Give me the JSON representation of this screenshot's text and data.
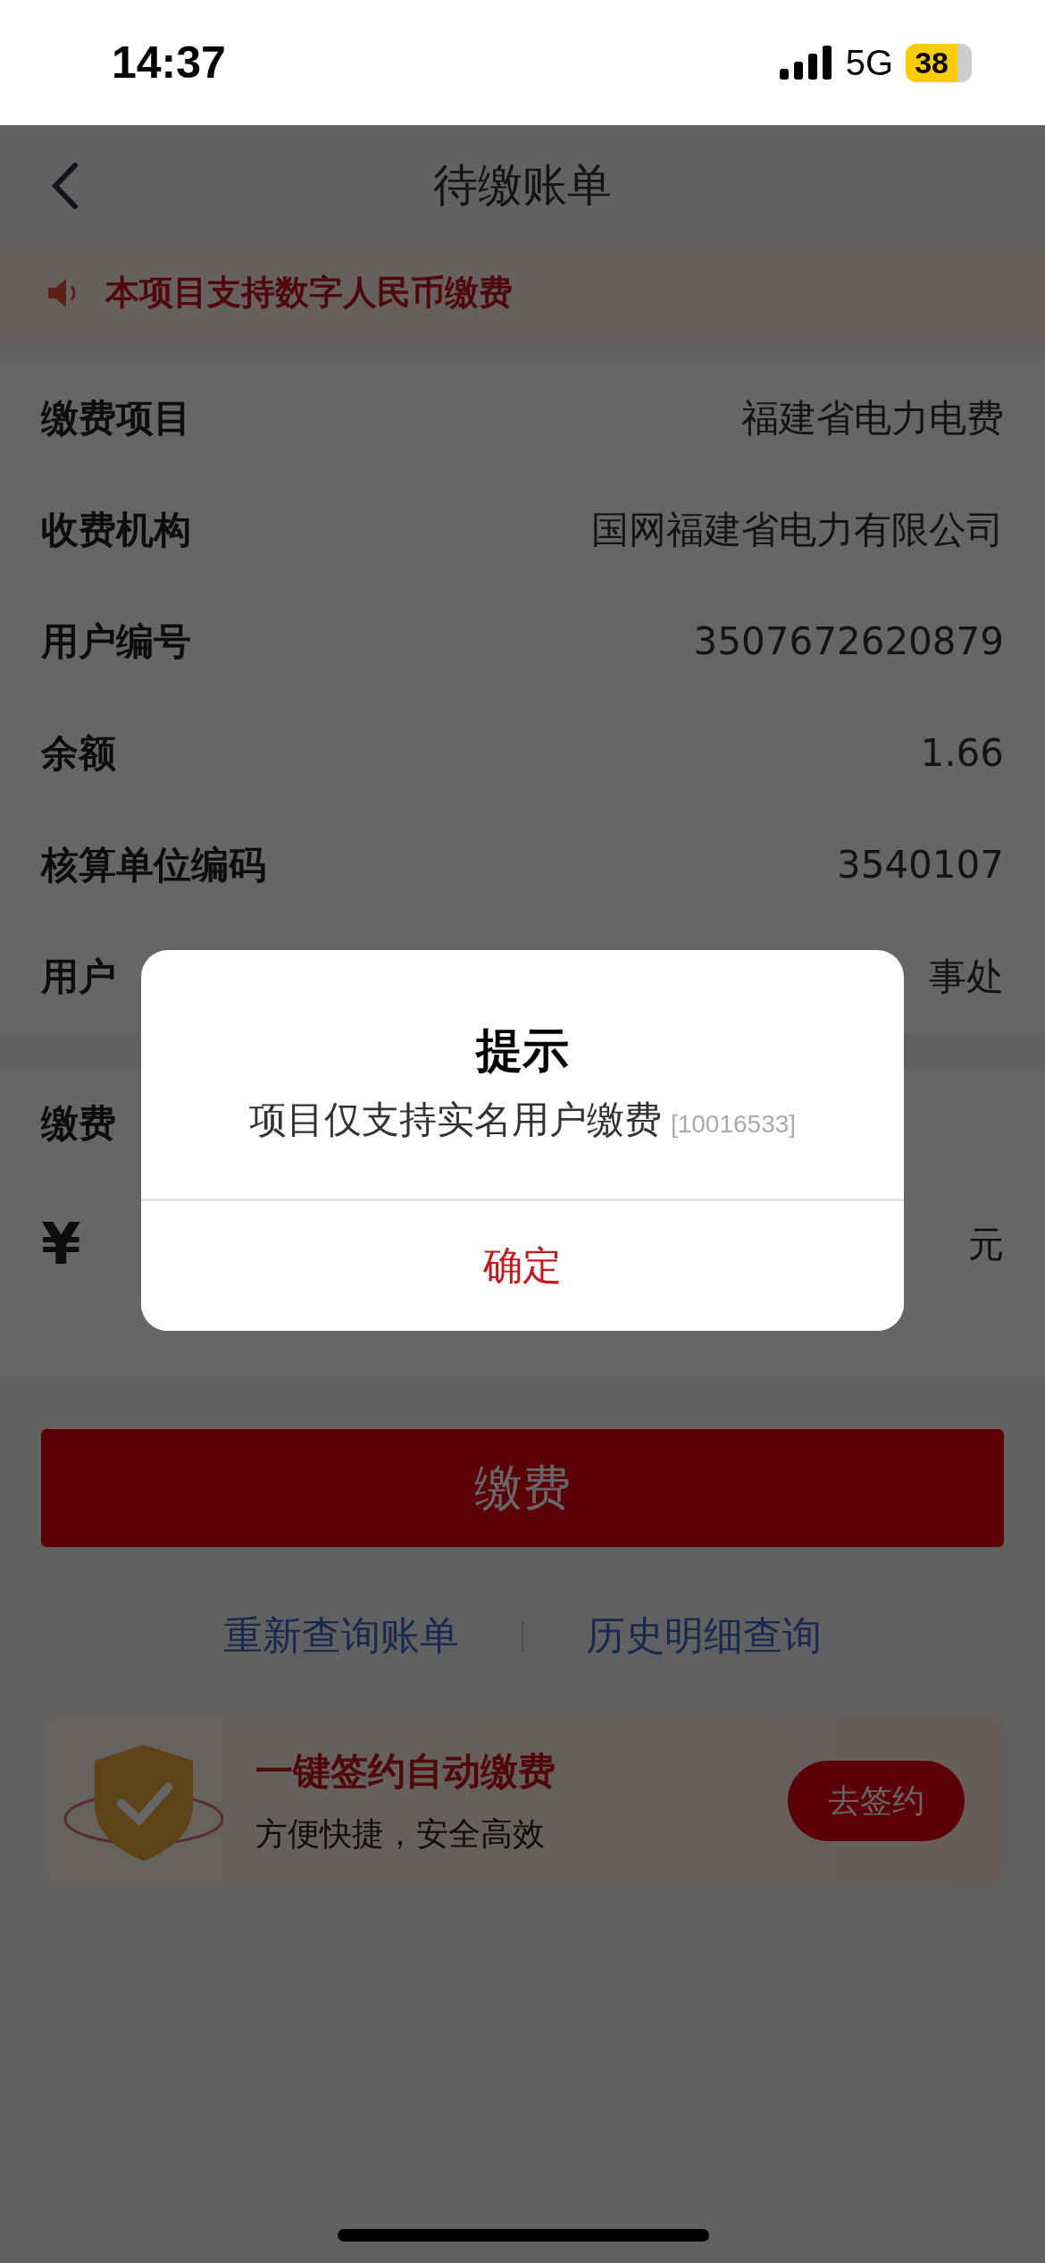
{
  "status_bar": {
    "time": "14:37",
    "network": "5G",
    "battery": "38"
  },
  "nav": {
    "title": "待缴账单"
  },
  "notice": {
    "text": "本项目支持数字人民币缴费"
  },
  "info_rows": [
    {
      "label": "缴费项目",
      "value": "福建省电力电费"
    },
    {
      "label": "收费机构",
      "value": "国网福建省电力有限公司"
    },
    {
      "label": "用户编号",
      "value": "3507672620879"
    },
    {
      "label": "余额",
      "value": "1.66"
    },
    {
      "label": "核算单位编码",
      "value": "3540107"
    },
    {
      "label": "用户",
      "value": "事处"
    }
  ],
  "amount": {
    "label": "缴费",
    "currency": "¥",
    "unit": "元"
  },
  "pay_button": "缴费",
  "links": [
    "重新查询账单",
    "历史明细查询"
  ],
  "promo": {
    "title": "一键签约自动缴费",
    "subtitle": "方便快捷，安全高效",
    "button": "去签约"
  },
  "dialog": {
    "title": "提示",
    "message": "项目仅支持实名用户缴费",
    "code": "[10016533]",
    "button": "确定"
  }
}
